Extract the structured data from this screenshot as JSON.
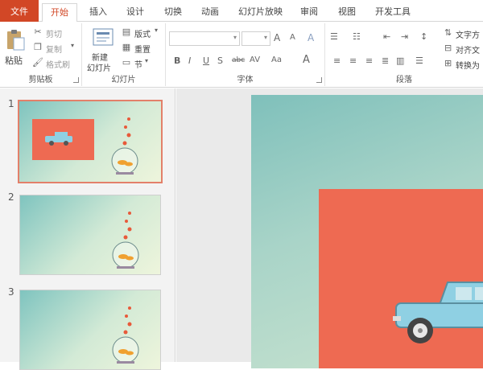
{
  "tabs": {
    "file": "文件",
    "items": [
      "开始",
      "插入",
      "设计",
      "切换",
      "动画",
      "幻灯片放映",
      "审阅",
      "视图",
      "开发工具"
    ]
  },
  "clipboard": {
    "paste": "粘贴",
    "cut": "剪切",
    "copy": "复制",
    "format_painter": "格式刷",
    "group_label": "剪贴板"
  },
  "slides_group": {
    "new_slide_line1": "新建",
    "new_slide_line2": "幻灯片",
    "layout": "版式",
    "reset": "重置",
    "section": "节",
    "group_label": "幻灯片"
  },
  "font_group": {
    "font_name": "",
    "font_size": "",
    "grow": "A",
    "shrink": "A",
    "clear": "A",
    "bold": "B",
    "italic": "I",
    "underline": "U",
    "shadow": "S",
    "strikethrough": "abc",
    "spacing": "AV",
    "change_case": "Aa",
    "font_color": "A",
    "group_label": "字体"
  },
  "paragraph_group": {
    "text_direction": "文字方",
    "align_text": "对齐文",
    "convert_smartart": "转换为",
    "group_label": "段落"
  },
  "slides": [
    {
      "number": "1",
      "selected": true
    },
    {
      "number": "2",
      "selected": false
    },
    {
      "number": "3",
      "selected": false
    }
  ],
  "colors": {
    "accent": "#d24726",
    "slide_red": "#ee6a52",
    "selection_border": "#e3806a",
    "car_blue": "#8fd0e3"
  }
}
